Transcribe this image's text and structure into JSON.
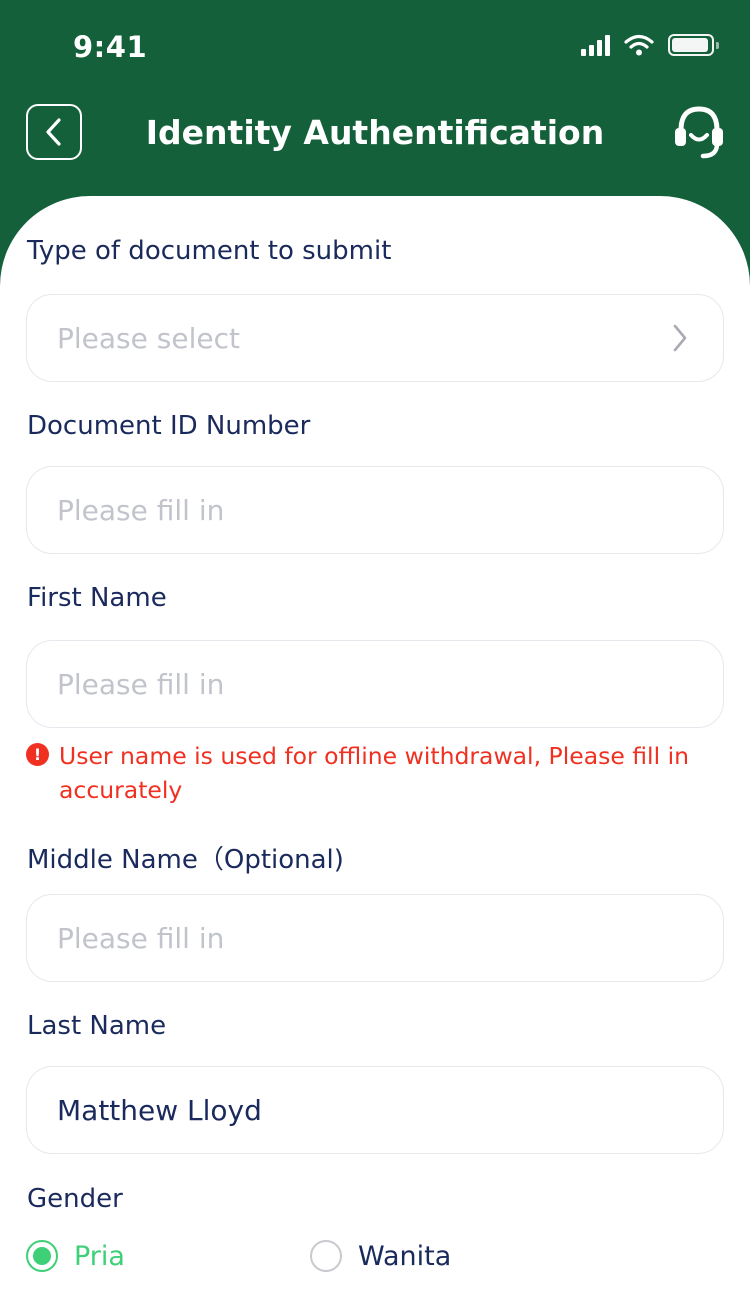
{
  "status_bar": {
    "time": "9:41"
  },
  "header": {
    "title": "Identity Authentification",
    "back_icon": "chevron-left-icon",
    "support_icon": "headset-icon"
  },
  "form": {
    "document_type": {
      "label": "Type of document to submit",
      "placeholder": "Please select"
    },
    "document_id": {
      "label": "Document ID Number",
      "placeholder": "Please fill in"
    },
    "first_name": {
      "label": "First Name",
      "placeholder": "Please fill in",
      "warning": "User name is used for offline withdrawal, Please fill in accurately"
    },
    "middle_name": {
      "label": "Middle Name（Optional)",
      "placeholder": "Please fill in"
    },
    "last_name": {
      "label": "Last Name",
      "value": "Matthew Lloyd"
    },
    "gender": {
      "label": "Gender",
      "options": [
        "Pria",
        "Wanita"
      ],
      "selected": "Pria"
    }
  },
  "colors": {
    "header_bg": "#14603a",
    "accent": "#3ecf77",
    "warning": "#f03020",
    "text": "#1a2a5c"
  }
}
